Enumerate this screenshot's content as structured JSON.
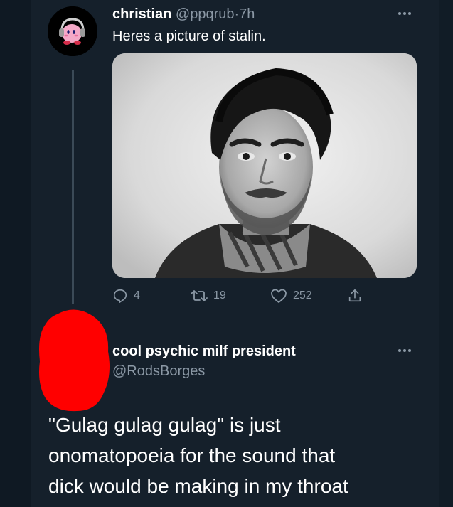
{
  "colors": {
    "background": "#15202b",
    "text_primary": "#ffffff",
    "text_secondary": "#8b98a5",
    "thread_line": "#3b4a57",
    "redaction": "#ff0000"
  },
  "tweet1": {
    "display_name": "christian",
    "handle": "@ppqrub",
    "separator": "·",
    "time": "7h",
    "text": "Heres a picture of stalin.",
    "avatar_icon": "kirby-headphones-avatar",
    "more_icon": "more-dots-icon",
    "image_alt": "black-and-white portrait photo",
    "actions": {
      "reply_count": "4",
      "retweet_count": "19",
      "like_count": "252"
    }
  },
  "tweet2": {
    "display_name": "cool psychic milf president",
    "handle": "@RodsBorges",
    "more_icon": "more-dots-icon",
    "avatar_redacted": true,
    "text": "\"Gulag gulag gulag\" is just\nonomatopoeia for the sound that\ndick would be making in my throat"
  }
}
